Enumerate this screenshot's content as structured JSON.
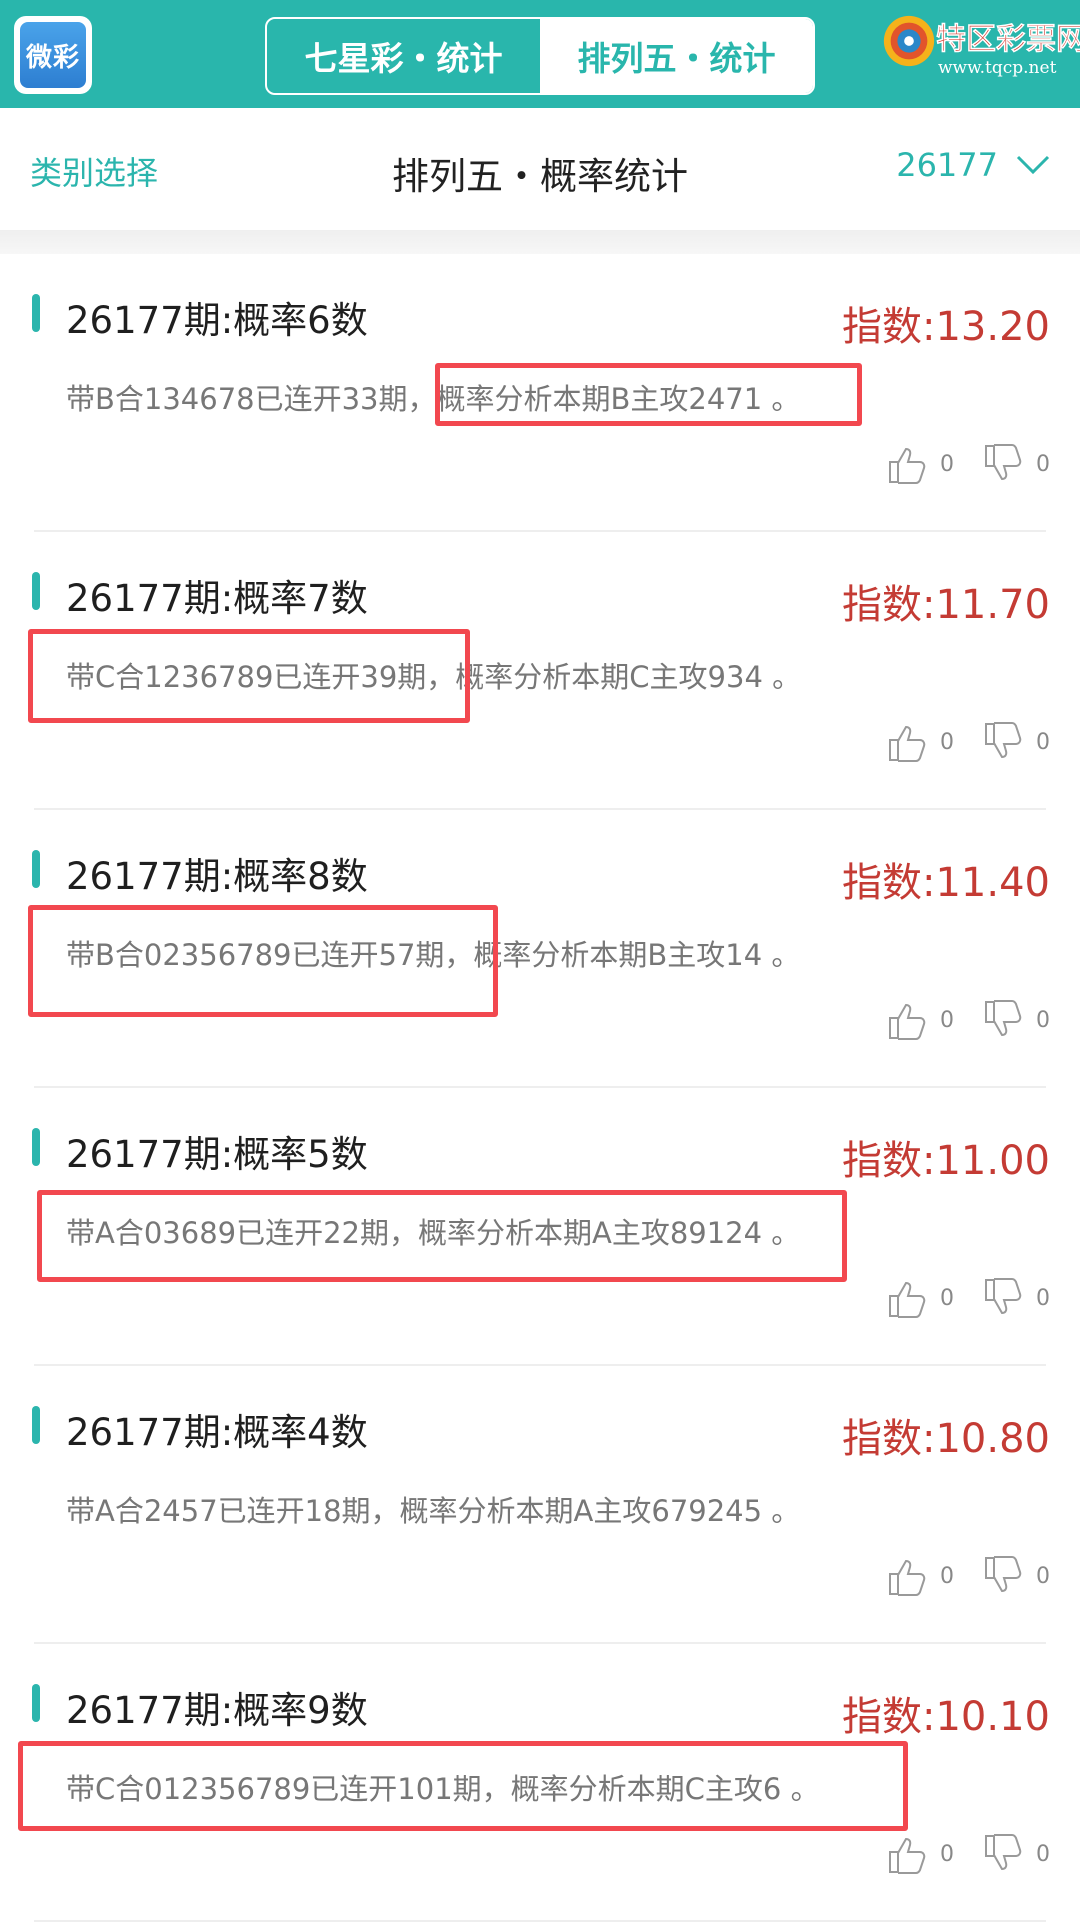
{
  "header": {
    "app_logo_text": "微彩",
    "tabs": [
      {
        "label": "七星彩・统计",
        "active": false
      },
      {
        "label": "排列五・统计",
        "active": true
      }
    ],
    "brand_name": "特区彩票网",
    "brand_url": "www.tqcp.net"
  },
  "subheader": {
    "category_label": "类别选择",
    "title": "排列五・概率统计",
    "issue_number": "26177"
  },
  "colors": {
    "accent": "#29b6ac",
    "index_red": "#c43b34",
    "highlight_red": "#f2484f"
  },
  "items": [
    {
      "title": "26177期:概率6数",
      "index": "指数:13.20",
      "desc": "带B合134678已连开33期，概率分析本期B主攻2471 。",
      "likes": "0",
      "dislikes": "0"
    },
    {
      "title": "26177期:概率7数",
      "index": "指数:11.70",
      "desc": "带C合1236789已连开39期，概率分析本期C主攻934 。",
      "likes": "0",
      "dislikes": "0"
    },
    {
      "title": "26177期:概率8数",
      "index": "指数:11.40",
      "desc": "带B合02356789已连开57期，概率分析本期B主攻14 。",
      "likes": "0",
      "dislikes": "0"
    },
    {
      "title": "26177期:概率5数",
      "index": "指数:11.00",
      "desc": "带A合03689已连开22期，概率分析本期A主攻89124 。",
      "likes": "0",
      "dislikes": "0"
    },
    {
      "title": "26177期:概率4数",
      "index": "指数:10.80",
      "desc": "带A合2457已连开18期，概率分析本期A主攻679245 。",
      "likes": "0",
      "dislikes": "0"
    },
    {
      "title": "26177期:概率9数",
      "index": "指数:10.10",
      "desc": "带C合012356789已连开101期，概率分析本期C主攻6 。",
      "likes": "0",
      "dislikes": "0"
    }
  ]
}
